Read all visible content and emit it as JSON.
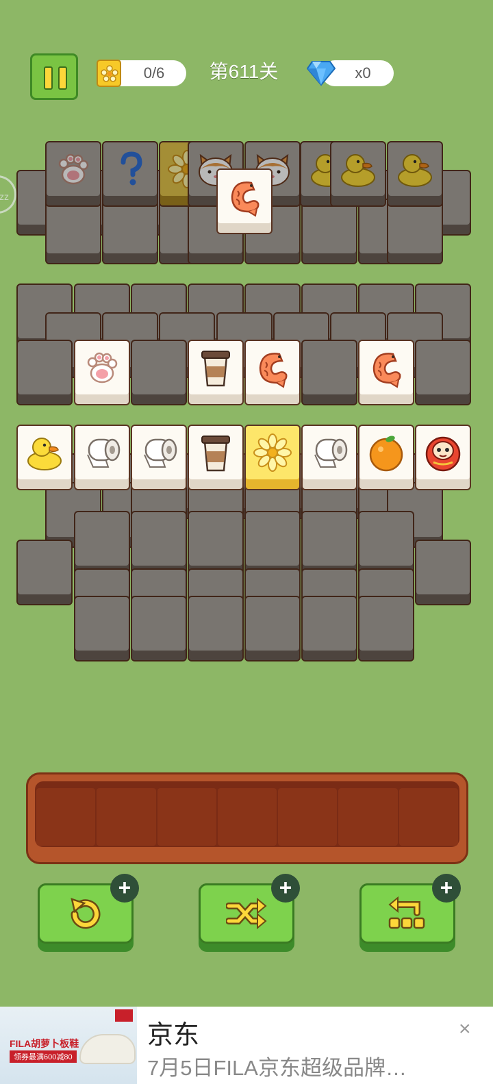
{
  "hud": {
    "flower_count": "0/6",
    "level": "第611关",
    "gem_count": "x0",
    "side_bubble": "zz"
  },
  "tiles": [
    {
      "icon": "paw",
      "tone": "dim"
    },
    {
      "icon": "question",
      "tone": "dim"
    },
    {
      "icon": "flower",
      "tone": "dim-yellow"
    },
    {
      "icon": "cat",
      "tone": "dim"
    },
    {
      "icon": "cat",
      "tone": "dim"
    },
    {
      "icon": "duck",
      "tone": "dim"
    },
    {
      "icon": "duck",
      "tone": "dim"
    },
    {
      "icon": "duck",
      "tone": "dim"
    },
    {
      "icon": "shrimp",
      "tone": "top"
    },
    {
      "icon": "paw",
      "tone": "top"
    },
    {
      "icon": "coffee",
      "tone": "top"
    },
    {
      "icon": "shrimp",
      "tone": "top"
    },
    {
      "icon": "shrimp",
      "tone": "top"
    },
    {
      "icon": "duck",
      "tone": "top"
    },
    {
      "icon": "toilet-paper",
      "tone": "top"
    },
    {
      "icon": "toilet-paper",
      "tone": "top"
    },
    {
      "icon": "coffee",
      "tone": "top"
    },
    {
      "icon": "flower",
      "tone": "top-yellow"
    },
    {
      "icon": "toilet-paper",
      "tone": "top"
    },
    {
      "icon": "orange",
      "tone": "top"
    },
    {
      "icon": "daruma",
      "tone": "top"
    }
  ],
  "tray": {
    "slot_count": 7
  },
  "tools": [
    {
      "name": "undo",
      "badge": "+"
    },
    {
      "name": "shuffle",
      "badge": "+"
    },
    {
      "name": "return",
      "badge": "+"
    }
  ],
  "ad": {
    "image_brand": "FILA胡萝卜板鞋",
    "image_sub": "领券最满600减80",
    "title": "京东",
    "description": "7月5日FILA京东超级品牌…",
    "close": "×"
  },
  "colors": {
    "background": "#8db766",
    "button_green": "#7ed24d",
    "tray_brown": "#b5552b"
  }
}
